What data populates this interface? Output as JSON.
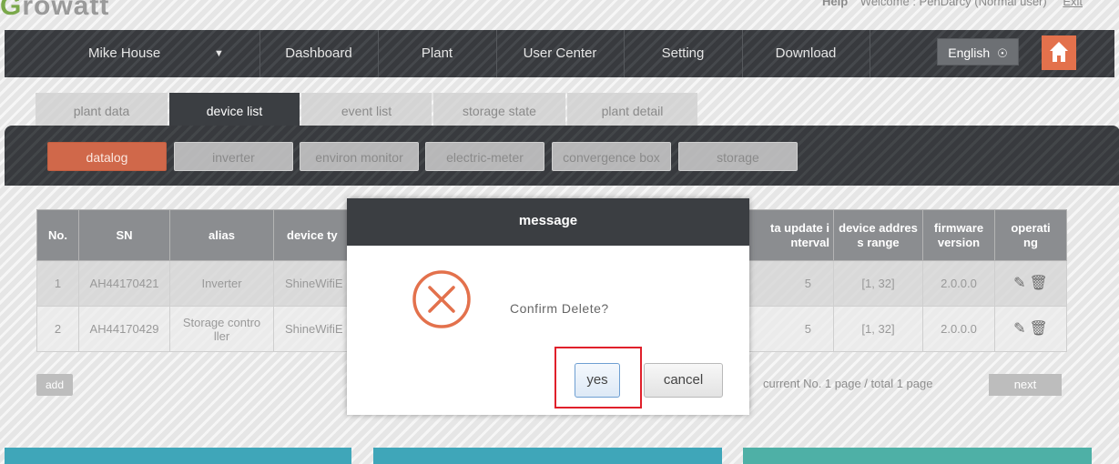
{
  "app": {
    "logo_text": "Growatt"
  },
  "topbar": {
    "help": "Help",
    "welcome": "Welcome : PenDarcy (Normal user)",
    "exit": "Exit"
  },
  "nav": {
    "plant_selector": "Mike House",
    "items": [
      "Dashboard",
      "Plant",
      "User Center",
      "Setting",
      "Download"
    ],
    "language": "English",
    "home_icon": "home-icon"
  },
  "tabs": [
    "plant data",
    "device list",
    "event list",
    "storage state",
    "plant detail"
  ],
  "active_tab": "device list",
  "subtabs": [
    "datalog",
    "inverter",
    "environ monitor",
    "electric-meter",
    "convergence box",
    "storage"
  ],
  "active_subtab": "datalog",
  "table": {
    "headers": [
      "No.",
      "SN",
      "alias",
      "device ty",
      "",
      "",
      "",
      "ta update i\nnterval",
      "device addres\ns range",
      "firmware\nversion",
      "operati\nng"
    ],
    "rows": [
      [
        "1",
        "AH44170421",
        "Inverter",
        "ShineWifiE",
        "",
        "",
        "",
        "5",
        "[1, 32]",
        "2.0.0.0",
        ""
      ],
      [
        "2",
        "AH44170429",
        "Storage contro\nller",
        "ShineWifiE",
        "",
        "",
        "",
        "5",
        "[1, 32]",
        "2.0.0.0",
        ""
      ]
    ]
  },
  "footer": {
    "add": "add",
    "pager": "current  No. 1 page / total 1 page",
    "next": "next"
  },
  "modal": {
    "title": "message",
    "message": "Confirm Delete?",
    "yes": "yes",
    "cancel": "cancel"
  },
  "colors": {
    "nav_bg": "#3b3e42",
    "accent": "#d0684a",
    "error_icon": "#e3714c",
    "highlight_box": "#e0202b",
    "panel_blue": "#3fa6b9",
    "panel_teal": "#4eb0a6"
  }
}
